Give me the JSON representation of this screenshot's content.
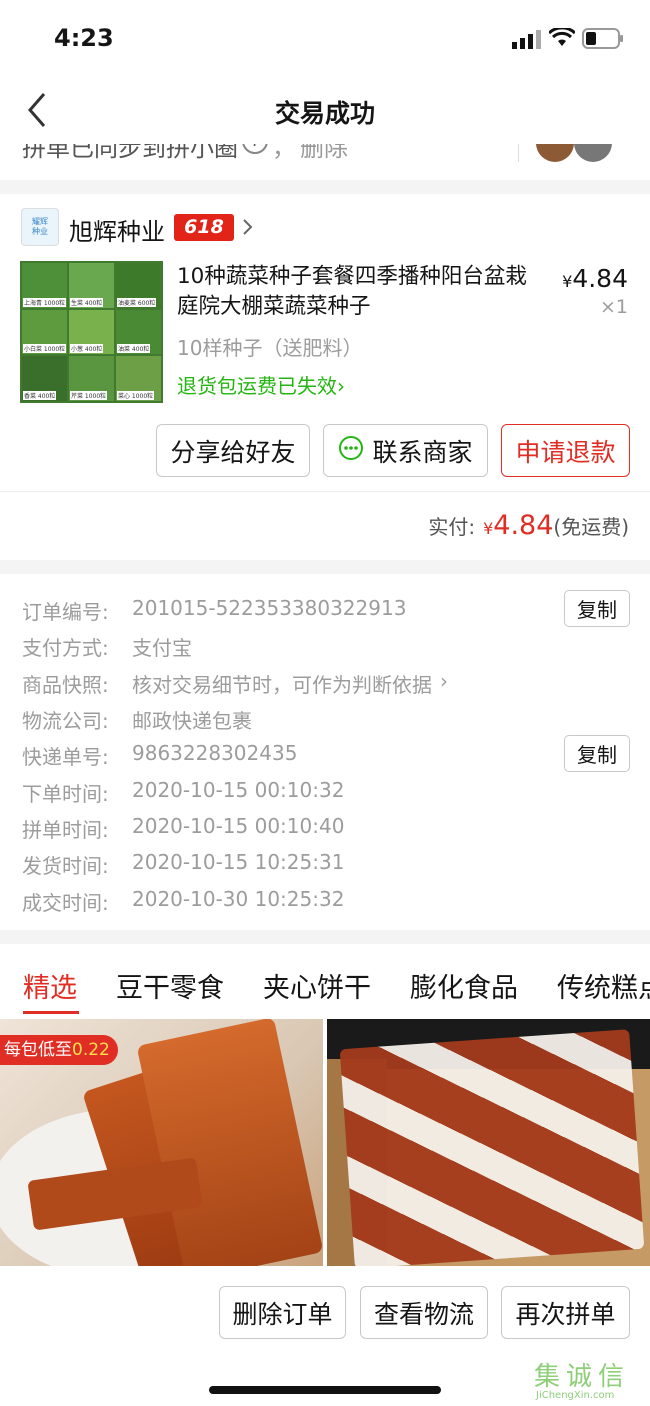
{
  "status_bar": {
    "time": "4:23"
  },
  "nav": {
    "title": "交易成功"
  },
  "partial_banner": {
    "text": "拼单已同步到拼小圈",
    "delete": "删除"
  },
  "store": {
    "logo_text": "耀辉种业",
    "name": "旭辉种业",
    "badge": "618"
  },
  "product": {
    "title": "10种蔬菜种子套餐四季播种阳台盆栽庭院大棚菜蔬菜种子",
    "price": "4.84",
    "currency": "¥",
    "qty": "×1",
    "spec": "10样种子（送肥料）",
    "return_note": "退货包运费已失效",
    "thumb_labels": [
      "上海青 1000粒",
      "生菜 400粒",
      "油麦菜 600粒",
      "小白菜 1000粒",
      "小葱 400粒",
      "油菜 400粒",
      "香菜 400粒",
      "菠菜 400粒",
      "芹菜 1000粒",
      "菜心 1000粒"
    ]
  },
  "actions": {
    "share": "分享给好友",
    "contact": "联系商家",
    "refund": "申请退款"
  },
  "payment": {
    "label": "实付:",
    "currency": "¥",
    "amount": "4.84",
    "note": "(免运费)"
  },
  "order_info": [
    {
      "key": "订单编号:",
      "value": "201015-522353380322913",
      "copy": "复制"
    },
    {
      "key": "支付方式:",
      "value": "支付宝"
    },
    {
      "key": "商品快照:",
      "value": "核对交易细节时，可作为判断依据"
    },
    {
      "key": "物流公司:",
      "value": "邮政快递包裹"
    },
    {
      "key": "快递单号:",
      "value": "9863228302435",
      "copy": "复制"
    },
    {
      "key": "下单时间:",
      "value": "2020-10-15 00:10:32"
    },
    {
      "key": "拼单时间:",
      "value": "2020-10-15 00:10:40"
    },
    {
      "key": "发货时间:",
      "value": "2020-10-15 10:25:31"
    },
    {
      "key": "成交时间:",
      "value": "2020-10-30 10:25:32"
    }
  ],
  "tabs": [
    "精选",
    "豆干零食",
    "夹心饼干",
    "膨化食品",
    "传统糕点"
  ],
  "promo": {
    "price_tag": "每包低至",
    "price_value": "0.22"
  },
  "bottom_actions": {
    "delete": "删除订单",
    "logistics": "查看物流",
    "rebuy": "再次拼单"
  },
  "watermark": {
    "cn": "集诚信",
    "en": "JiChengXin.com"
  },
  "colors": {
    "accent": "#e02e24",
    "green": "#25b513"
  }
}
